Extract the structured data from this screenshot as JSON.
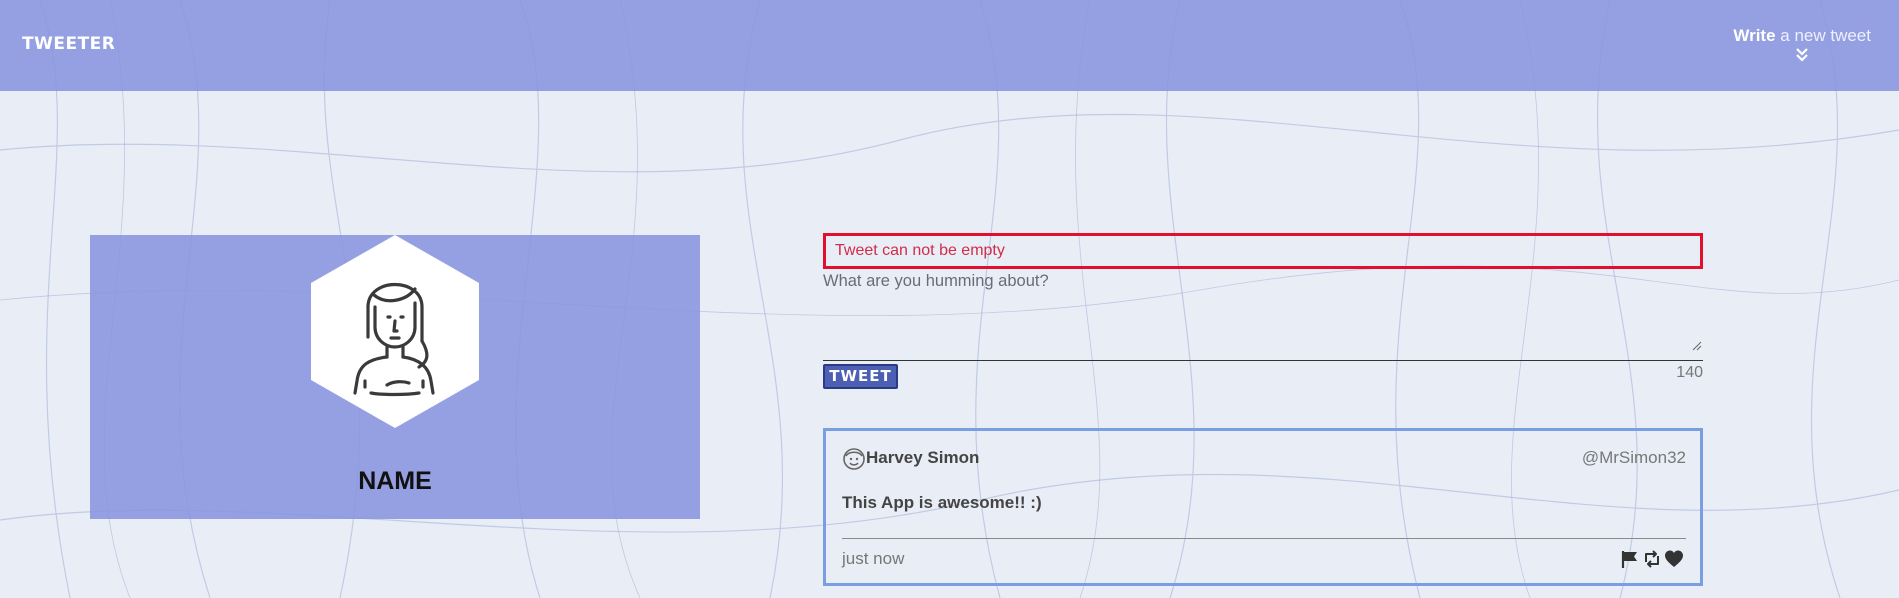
{
  "nav": {
    "logo": "TWEETER",
    "write_strong": "Write",
    "write_rest": " a new tweet",
    "write_icon": "double-chevron-down-icon"
  },
  "profile": {
    "name": "NAME",
    "avatar_icon": "woman-avatar-icon"
  },
  "composer": {
    "error": "Tweet can not be empty",
    "label": "What are you humming about?",
    "value": "",
    "button": "TWEET",
    "counter": "140"
  },
  "tweets": [
    {
      "avatar_icon": "smiley-avatar-icon",
      "name": "Harvey Simon",
      "handle": "@MrSimon32",
      "text": "This App is awesome!! :)",
      "time": "just now",
      "actions": [
        "flag-icon",
        "retweet-icon",
        "heart-icon"
      ]
    }
  ],
  "colors": {
    "brand": "#8795de",
    "error": "#e0102e",
    "button": "#4d5fb3",
    "card_border": "#7a9fe0",
    "background": "#e9edf6"
  }
}
